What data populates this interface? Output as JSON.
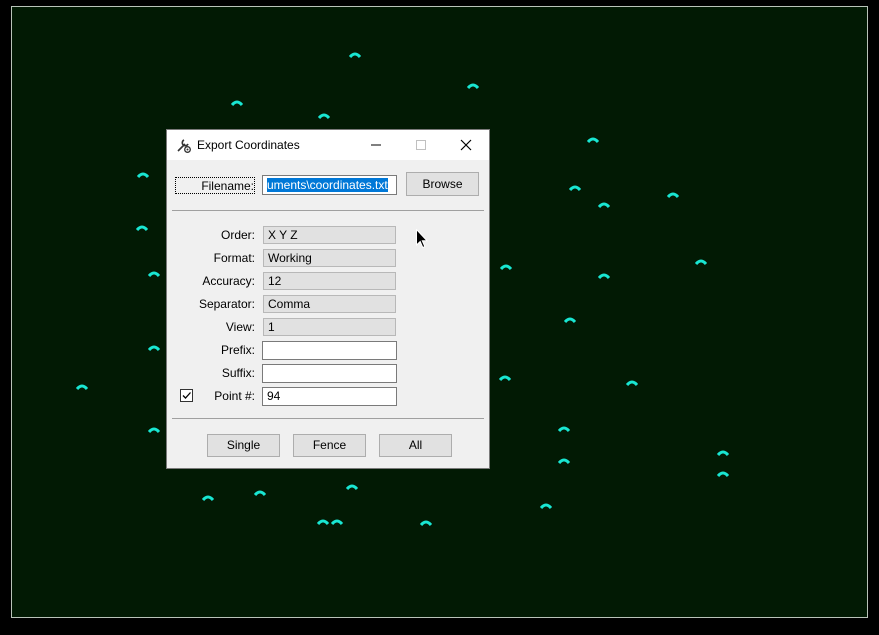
{
  "dialog": {
    "title": "Export Coordinates",
    "icon": "wrench-settings-icon",
    "filename_label": "Filename:",
    "filename_value": "uments\\coordinates.txt",
    "browse_label": "Browse",
    "fields": {
      "order": {
        "label": "Order:",
        "value": "X Y Z"
      },
      "format": {
        "label": "Format:",
        "value": "Working"
      },
      "accuracy": {
        "label": "Accuracy:",
        "value": "12"
      },
      "separator": {
        "label": "Separator:",
        "value": "Comma"
      },
      "view": {
        "label": "View:",
        "value": "1"
      },
      "prefix": {
        "label": "Prefix:",
        "value": ""
      },
      "suffix": {
        "label": "Suffix:",
        "value": ""
      },
      "point": {
        "label": "Point #:",
        "value": "94",
        "checked": true
      }
    },
    "buttons": {
      "single": "Single",
      "fence": "Fence",
      "all": "All"
    }
  },
  "colors": {
    "viewport_bg": "#021a04",
    "point_color": "#19e6d2",
    "selection": "#0078d7"
  },
  "cursor": "arrow-cursor-icon"
}
